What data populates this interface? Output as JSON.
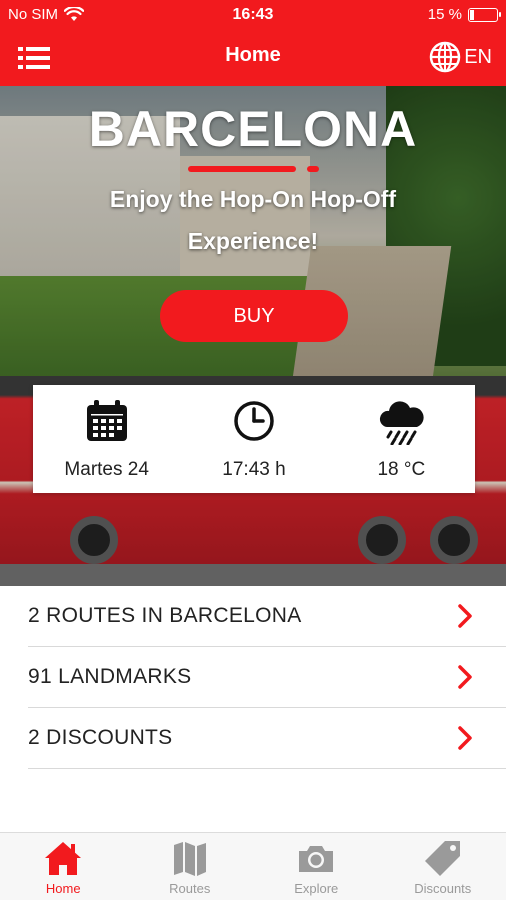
{
  "status_bar": {
    "carrier": "No SIM",
    "time": "16:43",
    "battery": "15 %"
  },
  "header": {
    "title": "Home",
    "language": "EN"
  },
  "hero": {
    "city": "BARCELONA",
    "tagline_line1": "Enjoy the Hop-On Hop-Off",
    "tagline_line2": "Experience!",
    "buy_label": "BUY"
  },
  "info": {
    "date": "Martes 24",
    "time": "17:43 h",
    "temperature": "18 °C"
  },
  "list": [
    {
      "label": "2 ROUTES IN BARCELONA"
    },
    {
      "label": "91 LANDMARKS"
    },
    {
      "label": "2 DISCOUNTS"
    }
  ],
  "tabs": [
    {
      "label": "Home",
      "icon": "home-icon",
      "active": true
    },
    {
      "label": "Routes",
      "icon": "map-icon",
      "active": false
    },
    {
      "label": "Explore",
      "icon": "camera-icon",
      "active": false
    },
    {
      "label": "Discounts",
      "icon": "tag-icon",
      "active": false
    }
  ],
  "colors": {
    "accent": "#f21a1e",
    "inactive_tab": "#9a9a9a"
  }
}
